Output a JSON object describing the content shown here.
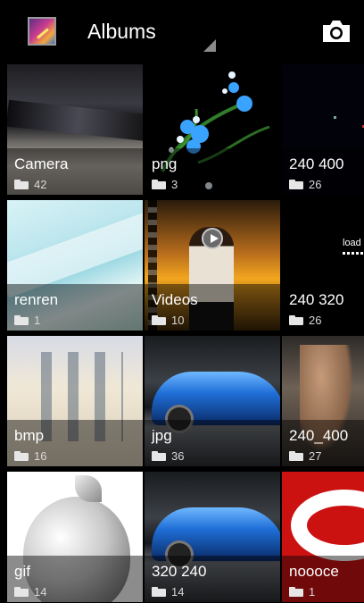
{
  "header": {
    "title": "Albums",
    "app_icon": "gallery-app-icon",
    "camera_icon": "camera-icon"
  },
  "albums": [
    {
      "name": "Camera",
      "count": "42"
    },
    {
      "name": "png",
      "count": "3"
    },
    {
      "name": "240 400",
      "count": "26"
    },
    {
      "name": "renren",
      "count": "1"
    },
    {
      "name": "Videos",
      "count": "10"
    },
    {
      "name": "240 320",
      "count": "26"
    },
    {
      "name": "bmp",
      "count": "16"
    },
    {
      "name": "jpg",
      "count": "36"
    },
    {
      "name": "240_400",
      "count": "27"
    },
    {
      "name": "gif",
      "count": "14"
    },
    {
      "name": "320 240",
      "count": "14"
    },
    {
      "name": "noooce",
      "count": "1"
    }
  ],
  "thumbnails": {
    "load_text": "load"
  }
}
